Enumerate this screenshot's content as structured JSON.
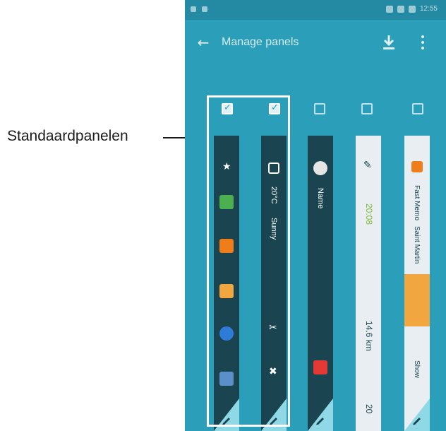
{
  "callout": {
    "label": "Standaardpanelen"
  },
  "app": {
    "title": "Manage panels",
    "status_time": "12:55",
    "back_icon": "arrow-left-icon",
    "download_icon": "download-icon",
    "more_icon": "more-vertical-icon"
  },
  "panels": [
    {
      "checked": true,
      "apps": [
        "star-icon",
        "phone-icon",
        "contacts-icon",
        "email-icon",
        "internet-icon",
        "gallery-icon"
      ]
    },
    {
      "checked": true,
      "weather_temp": "20°C",
      "weather_desc": "Sunny",
      "tool_icons": [
        "calendar-icon",
        "wrench-icon",
        "cross-icon"
      ]
    },
    {
      "checked": false,
      "text": "Name"
    },
    {
      "checked": false,
      "time": "20:08",
      "distance": "14.6 km",
      "value": "20"
    },
    {
      "checked": false,
      "text1": "Fast Memo",
      "text2": "Saint Martin",
      "text3": "Show"
    }
  ]
}
